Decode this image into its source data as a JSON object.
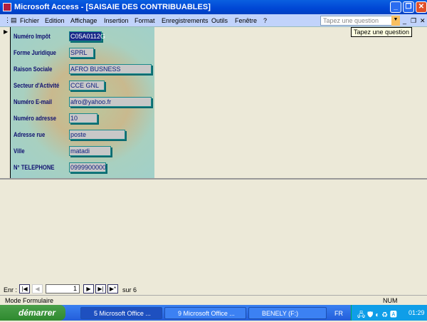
{
  "window": {
    "title": "Microsoft Access - [SAISAIE DES CONTRIBUABLES]"
  },
  "menu": [
    "Fichier",
    "Edition",
    "Affichage",
    "Insertion",
    "Format",
    "Enregistrements",
    "Outils",
    "Fenêtre",
    "?"
  ],
  "help": {
    "placeholder": "Tapez une question",
    "tooltip": "Tapez une question"
  },
  "form": {
    "fields": [
      {
        "label": "Numéro Impôt",
        "value": "C05A0112G"
      },
      {
        "label": "Forme Juridique",
        "value": "SPRL"
      },
      {
        "label": "Raison Sociale",
        "value": "AFRO BUSNESS"
      },
      {
        "label": "Secteur d'Activité",
        "value": "CCE GNL"
      },
      {
        "label": "Numéro E-mail",
        "value": "afro@yahoo.fr"
      },
      {
        "label": "Numéro adresse",
        "value": "10"
      },
      {
        "label": "Adresse rue",
        "value": "poste"
      },
      {
        "label": "Ville",
        "value": "matadi"
      },
      {
        "label": "N° TELEPHONE",
        "value": "0999900000"
      }
    ]
  },
  "nav": {
    "label": "Enr :",
    "current": "1",
    "of": "sur",
    "total": "6"
  },
  "status": {
    "mode": "Mode Formulaire",
    "num": "NUM"
  },
  "taskbar": {
    "start": "démarrer",
    "tasks": [
      "5 Microsoft Office ...",
      "9 Microsoft Office ...",
      "BENELY (F:)"
    ],
    "lang": "FR",
    "clock": "01:29"
  }
}
